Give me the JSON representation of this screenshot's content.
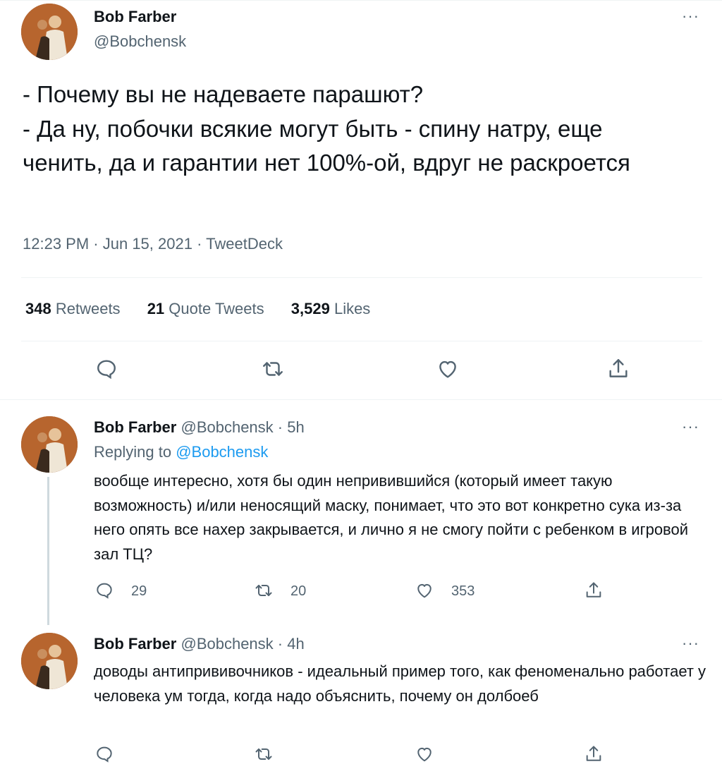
{
  "main_tweet": {
    "author_name": "Bob Farber",
    "author_handle": "@Bobchensk",
    "text": "- Почему вы не надеваете парашют?\n- Да ну, побочки всякие могут быть - спину натру, еще ченить, да и гарантии нет 100%-ой, вдруг не раскроется",
    "time": "12:23 PM",
    "date": "Jun 15, 2021",
    "source": "TweetDeck",
    "separator": " · ",
    "stats": {
      "retweets_count": "348",
      "retweets_label": "Retweets",
      "quotes_count": "21",
      "quotes_label": "Quote Tweets",
      "likes_count": "3,529",
      "likes_label": "Likes"
    }
  },
  "more_glyph": "···",
  "replies": [
    {
      "author_name": "Bob Farber",
      "author_handle": "@Bobchensk",
      "age": "· 5h",
      "replying_prefix": "Replying to",
      "replying_to": "@Bobchensk",
      "text": "вообще интересно, хотя бы один непривившийся (который имеет такую возможность) и/или неносящий маску, понимает, что это вот конкретно сука из-за него опять все нахер закрывается, и лично я не смогу пойти с ребенком в игровой зал ТЦ?",
      "reply_count": "29",
      "retweet_count": "20",
      "like_count": "353"
    },
    {
      "author_name": "Bob Farber",
      "author_handle": "@Bobchensk",
      "age": "· 4h",
      "text": "доводы антипрививочников - идеальный пример того, как феноменально работает у человека ум тогда, когда надо объяснить, почему он долбоеб"
    }
  ],
  "icons": {
    "reply": "reply-icon",
    "retweet": "retweet-icon",
    "like": "heart-icon",
    "share": "share-icon",
    "more": "more-icon"
  },
  "colors": {
    "text": "#0f1419",
    "secondary": "#536471",
    "link": "#1d9bf0",
    "divider": "#eff3f4",
    "thread_line": "#cfd9de"
  }
}
